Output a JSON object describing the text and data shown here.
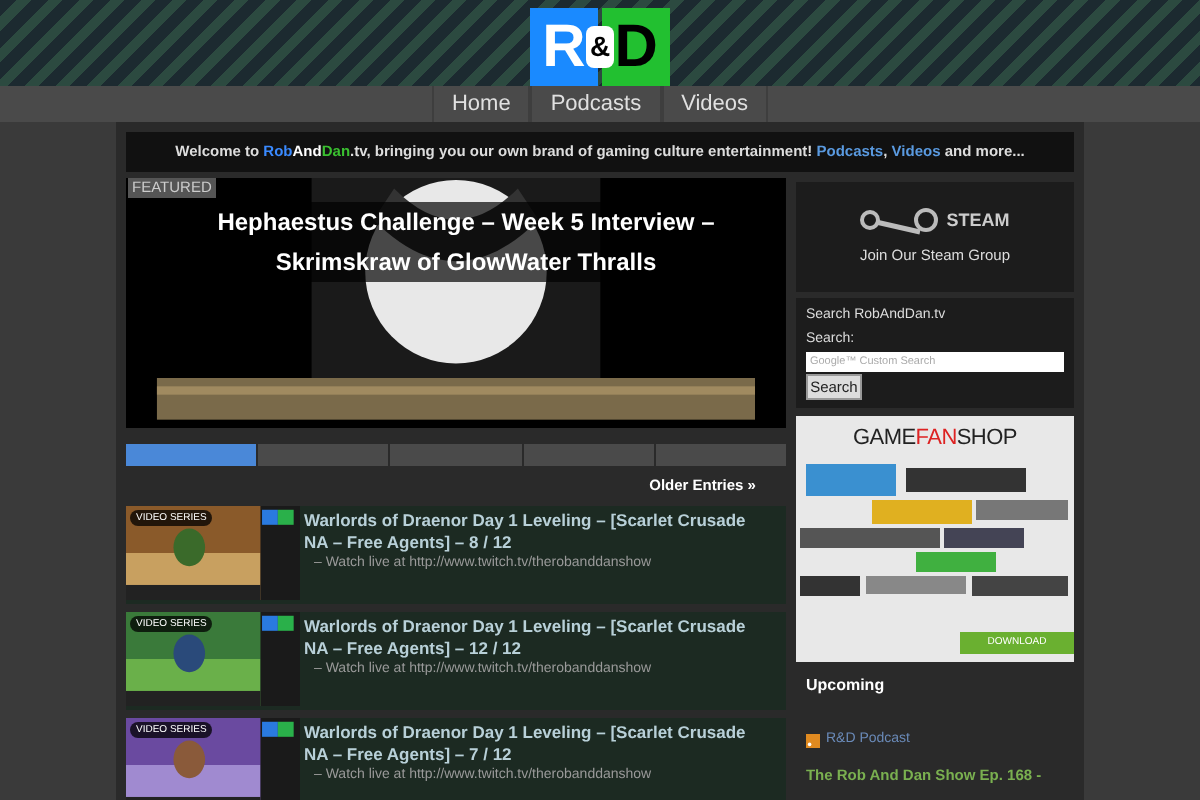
{
  "logo": {
    "left": "R",
    "amp": "&",
    "right": "D"
  },
  "nav": [
    {
      "label": "Home"
    },
    {
      "label": "Podcasts"
    },
    {
      "label": "Videos"
    }
  ],
  "welcome": {
    "before": "Welcome to ",
    "rob": "Rob",
    "and": "And",
    "dan": "Dan",
    "after": ".tv, bringing you our own brand of gaming culture entertainment!",
    "link1": "Podcasts",
    "sep": ",",
    "link2": "Videos",
    "end": "and more..."
  },
  "featured": {
    "badge": "FEATURED",
    "title": "Hephaestus Challenge – Week 5 Interview – Skrimskraw of GlowWater Thralls",
    "slides": [
      {
        "selected": true
      },
      {
        "selected": false
      },
      {
        "selected": false
      },
      {
        "selected": false
      },
      {
        "selected": false
      }
    ]
  },
  "older_entries": "Older Entries »",
  "posts": [
    {
      "badge": "VIDEO SERIES",
      "title": "Warlords of Draenor Day 1 Leveling – [Scarlet Crusade NA – Free Agents] – 8 / 12",
      "excerpt": "– Watch live at http://www.twitch.tv/therobanddanshow"
    },
    {
      "badge": "VIDEO SERIES",
      "title": "Warlords of Draenor Day 1 Leveling – [Scarlet Crusade NA – Free Agents] – 12 / 12",
      "excerpt": "– Watch live at http://www.twitch.tv/therobanddanshow"
    },
    {
      "badge": "VIDEO SERIES",
      "title": "Warlords of Draenor Day 1 Leveling – [Scarlet Crusade NA – Free Agents] – 7 / 12",
      "excerpt": "– Watch live at http://www.twitch.tv/therobanddanshow"
    }
  ],
  "sidebar": {
    "steam_word": "STEAM",
    "steam_link": "Join Our Steam Group",
    "search_title": "Search RobAndDan.tv",
    "search_label": "Search:",
    "search_placeholder": "Google™ Custom Search",
    "search_button": "Search",
    "ad_title_a": "GAME",
    "ad_title_b": "FAN",
    "ad_title_c": "SHOP",
    "ad_button": "DOWNLOAD",
    "upcoming": "Upcoming",
    "feed": "R&D Podcast",
    "feed_item": "The Rob And Dan Show Ep. 168 -"
  }
}
